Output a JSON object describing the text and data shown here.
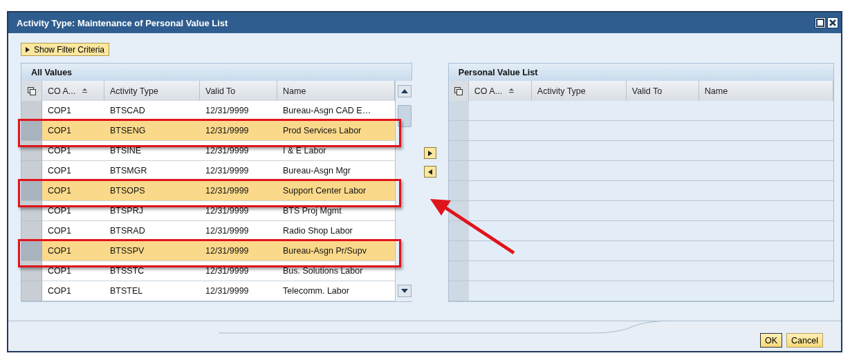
{
  "window": {
    "title": "Activity Type: Maintenance of Personal Value List"
  },
  "filter_button": {
    "label": "Show Filter Criteria"
  },
  "all_values": {
    "title": "All Values",
    "columns": [
      {
        "label": "CO A...",
        "sorted": true
      },
      {
        "label": "Activity Type",
        "sorted": false
      },
      {
        "label": "Valid To",
        "sorted": false
      },
      {
        "label": "Name",
        "sorted": false
      }
    ],
    "rows": [
      {
        "cells": [
          "COP1",
          "BTSCAD",
          "12/31/9999",
          "Bureau-Asgn CAD E…"
        ],
        "selected": false
      },
      {
        "cells": [
          "COP1",
          "BTSENG",
          "12/31/9999",
          "Prod Services Labor"
        ],
        "selected": true
      },
      {
        "cells": [
          "COP1",
          "BTSINE",
          "12/31/9999",
          "I & E Labor"
        ],
        "selected": false
      },
      {
        "cells": [
          "COP1",
          "BTSMGR",
          "12/31/9999",
          "Bureau-Asgn Mgr"
        ],
        "selected": false
      },
      {
        "cells": [
          "COP1",
          "BTSOPS",
          "12/31/9999",
          "Support Center Labor"
        ],
        "selected": true
      },
      {
        "cells": [
          "COP1",
          "BTSPRJ",
          "12/31/9999",
          "BTS Proj Mgmt"
        ],
        "selected": false
      },
      {
        "cells": [
          "COP1",
          "BTSRAD",
          "12/31/9999",
          "Radio Shop Labor"
        ],
        "selected": false
      },
      {
        "cells": [
          "COP1",
          "BTSSPV",
          "12/31/9999",
          "Bureau-Asgn Pr/Supv"
        ],
        "selected": true
      },
      {
        "cells": [
          "COP1",
          "BTSSTC",
          "12/31/9999",
          "Bus. Solutions Labor"
        ],
        "selected": false
      },
      {
        "cells": [
          "COP1",
          "BTSTEL",
          "12/31/9999",
          "Telecomm. Labor"
        ],
        "selected": false
      }
    ]
  },
  "personal_list": {
    "title": "Personal Value List",
    "columns": [
      {
        "label": "CO A...",
        "sorted": true
      },
      {
        "label": "Activity Type",
        "sorted": false
      },
      {
        "label": "Valid To",
        "sorted": false
      },
      {
        "label": "Name",
        "sorted": false
      }
    ]
  },
  "buttons": [
    {
      "label": "OK",
      "default": true
    },
    {
      "label": "Cancel",
      "default": false
    }
  ]
}
